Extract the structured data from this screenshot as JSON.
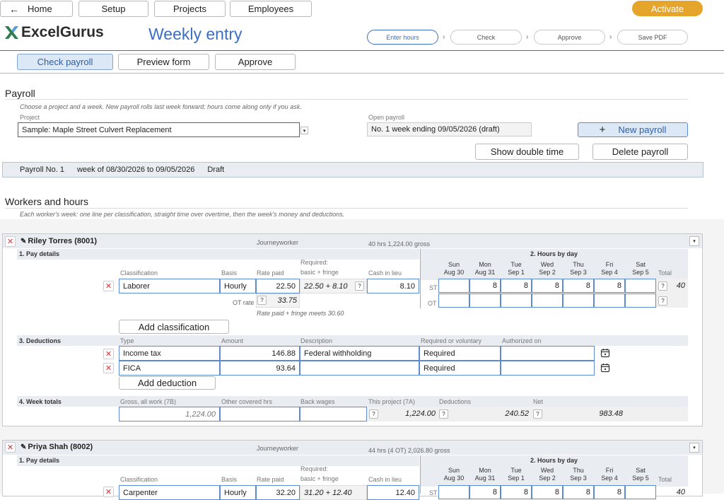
{
  "topnav": {
    "home": "Home",
    "setup": "Setup",
    "projects": "Projects",
    "employees": "Employees",
    "activate": "Activate"
  },
  "brand": {
    "logo": "ExcelGurus",
    "page_title": "Weekly entry"
  },
  "steps": [
    "Enter hours",
    "Check",
    "Approve",
    "Save PDF"
  ],
  "tabs": [
    "Check payroll",
    "Preview form",
    "Approve"
  ],
  "payroll": {
    "heading": "Payroll",
    "hint": "Choose a project and a week. New payroll rolls last week forward; hours come along only if you ask.",
    "project_label": "Project",
    "project_value": "Sample: Maple Street Culvert Replacement",
    "open_label": "Open payroll",
    "open_value": "No. 1   week ending 09/05/2026  (draft)",
    "new_button": "New payroll",
    "show_dt_button": "Show double time",
    "delete_button": "Delete payroll",
    "status": {
      "number": "Payroll No. 1",
      "week": "week of 08/30/2026 to 09/05/2026",
      "state": "Draft"
    }
  },
  "workers_section": {
    "heading": "Workers and hours",
    "hint": "Each worker's week: one line per classification, straight time over overtime, then the week's money and deductions."
  },
  "labels": {
    "pay_details": "1. Pay details",
    "hours_by_day": "2. Hours by day",
    "deductions": "3. Deductions",
    "week_totals": "4. Week totals",
    "classification": "Classification",
    "basis": "Basis",
    "rate_paid": "Rate paid",
    "required_l1": "Required:",
    "required_l2": "basic + fringe",
    "cash_in_lieu": "Cash in lieu",
    "total": "Total",
    "st": "ST",
    "ot": "OT",
    "ot_rate": "OT rate",
    "add_classification": "Add classification",
    "add_deduction": "Add deduction",
    "type": "Type",
    "amount": "Amount",
    "description": "Description",
    "req_vol": "Required or voluntary",
    "authorized_on": "Authorized on",
    "gross_all": "Gross, all work (7B)",
    "other_hrs": "Other covered hrs",
    "back_wages": "Back wages",
    "this_project": "This project (7A)",
    "deductions_col": "Deductions",
    "net": "Net",
    "q": "?"
  },
  "days": [
    {
      "dow": "Sun",
      "date": "Aug 30"
    },
    {
      "dow": "Mon",
      "date": "Aug 31"
    },
    {
      "dow": "Tue",
      "date": "Sep 1"
    },
    {
      "dow": "Wed",
      "date": "Sep 2"
    },
    {
      "dow": "Thu",
      "date": "Sep 3"
    },
    {
      "dow": "Fri",
      "date": "Sep 4"
    },
    {
      "dow": "Sat",
      "date": "Sep 5"
    }
  ],
  "workers": [
    {
      "name": "Riley Torres (8001)",
      "level": "Journeyworker",
      "summary": "40 hrs   1,224.00 gross",
      "classification": "Laborer",
      "basis": "Hourly",
      "rate_paid": "22.50",
      "required": "22.50 + 8.10",
      "cash_in_lieu": "8.10",
      "ot_rate": "33.75",
      "rate_note": "Rate paid + fringe meets 30.60",
      "st_hours": [
        "",
        "8",
        "8",
        "8",
        "8",
        "8",
        ""
      ],
      "st_total": "40",
      "deductions": [
        {
          "type": "Income tax",
          "amount": "146.88",
          "description": "Federal withholding",
          "req": "Required"
        },
        {
          "type": "FICA",
          "amount": "93.64",
          "description": "",
          "req": "Required"
        }
      ],
      "totals": {
        "gross_all": "1,224.00",
        "this_project": "1,224.00",
        "deductions": "240.52",
        "net": "983.48"
      }
    },
    {
      "name": "Priya Shah (8002)",
      "level": "Journeyworker",
      "summary": "44 hrs (4 OT)   2,026.80 gross",
      "classification": "Carpenter",
      "basis": "Hourly",
      "rate_paid": "32.20",
      "required": "31.20 + 12.40",
      "cash_in_lieu": "12.40",
      "st_hours": [
        "",
        "8",
        "8",
        "8",
        "8",
        "8",
        ""
      ],
      "st_total": "40"
    }
  ]
}
